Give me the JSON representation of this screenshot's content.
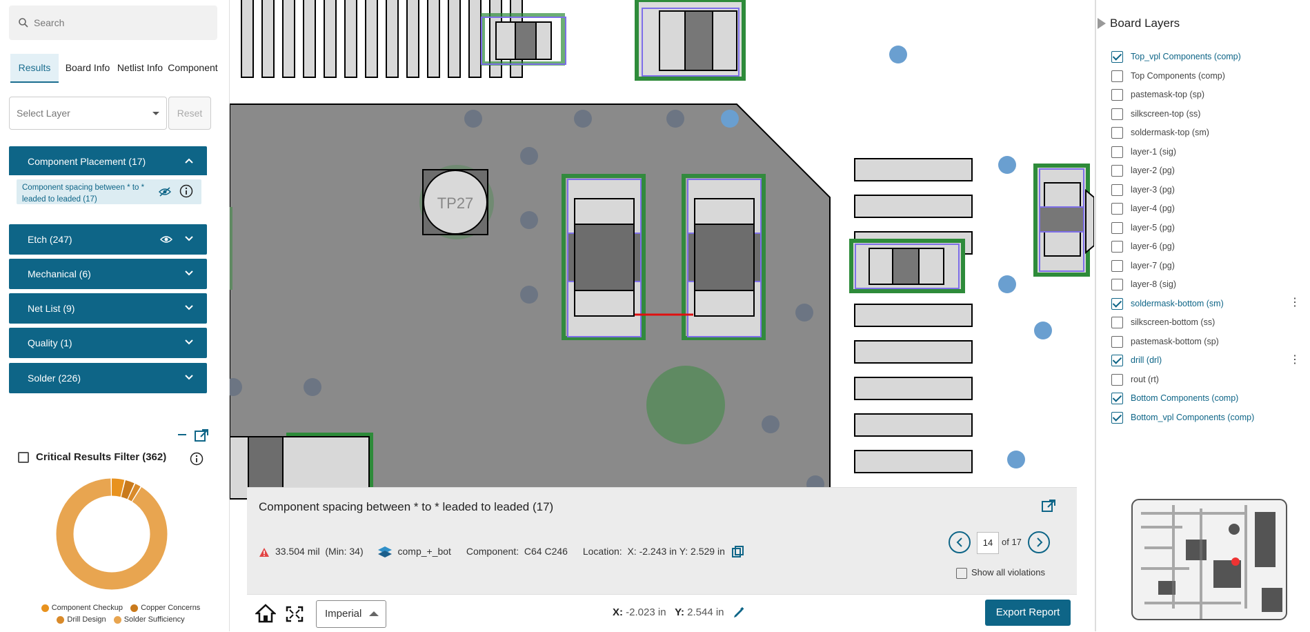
{
  "search": {
    "placeholder": "Search"
  },
  "tabs": [
    {
      "label": "Results",
      "active": true
    },
    {
      "label": "Board Info"
    },
    {
      "label": "Netlist Info"
    },
    {
      "label": "Component"
    }
  ],
  "layer_select": {
    "placeholder": "Select Layer",
    "reset_label": "Reset"
  },
  "categories": [
    {
      "label": "Component Placement (17)",
      "expanded": true
    },
    {
      "label": "Etch (247)"
    },
    {
      "label": "Mechanical (6)"
    },
    {
      "label": "Net List (9)"
    },
    {
      "label": "Quality (1)"
    },
    {
      "label": "Solder (226)"
    }
  ],
  "sub_rule": {
    "label": "Component spacing between * to * leaded to leaded (17)"
  },
  "critical_filter": {
    "label": "Critical Results Filter (362)"
  },
  "donut": {
    "legend": [
      "Component Checkup",
      "Copper Concerns",
      "Drill Design",
      "Solder Sufficiency"
    ],
    "colors": [
      "#e8921e",
      "#c97a1c",
      "#d98a2a",
      "#e8a550"
    ],
    "fractions": [
      0.04,
      0.03,
      0.02,
      0.91
    ]
  },
  "canvas": {
    "label": "TP27"
  },
  "board_layers": {
    "title": "Board Layers",
    "items": [
      {
        "name": "Top_vpl Components (comp)",
        "checked": true
      },
      {
        "name": "Top Components (comp)",
        "checked": false
      },
      {
        "name": "pastemask-top (sp)",
        "checked": false
      },
      {
        "name": "silkscreen-top (ss)",
        "checked": false
      },
      {
        "name": "soldermask-top (sm)",
        "checked": false
      },
      {
        "name": "layer-1 (sig)",
        "checked": false
      },
      {
        "name": "layer-2 (pg)",
        "checked": false
      },
      {
        "name": "layer-3 (pg)",
        "checked": false
      },
      {
        "name": "layer-4 (pg)",
        "checked": false
      },
      {
        "name": "layer-5 (pg)",
        "checked": false
      },
      {
        "name": "layer-6 (pg)",
        "checked": false
      },
      {
        "name": "layer-7 (pg)",
        "checked": false
      },
      {
        "name": "layer-8 (sig)",
        "checked": false
      },
      {
        "name": "soldermask-bottom (sm)",
        "checked": true
      },
      {
        "name": "silkscreen-bottom (ss)",
        "checked": false
      },
      {
        "name": "pastemask-bottom (sp)",
        "checked": false
      },
      {
        "name": "drill (drl)",
        "checked": true
      },
      {
        "name": "rout (rt)",
        "checked": false
      },
      {
        "name": "Bottom Components (comp)",
        "checked": true
      },
      {
        "name": "Bottom_vpl Components (comp)",
        "checked": true
      }
    ]
  },
  "violation": {
    "title": "Component spacing between * to * leaded to leaded (17)",
    "value": "33.504 mil",
    "min": "(Min: 34)",
    "layer": "comp_+_bot",
    "component_label": "Component:",
    "component_value": "C64 C246",
    "location_label": "Location:",
    "location_value": "X: -2.243 in Y: 2.529 in",
    "page": "14",
    "page_of": "of 17",
    "show_all": "Show all violations"
  },
  "toolbar": {
    "units": "Imperial",
    "x_label": "X:",
    "x_value": "-2.023 in",
    "y_label": "Y:",
    "y_value": "2.544 in",
    "export_label": "Export Report"
  }
}
